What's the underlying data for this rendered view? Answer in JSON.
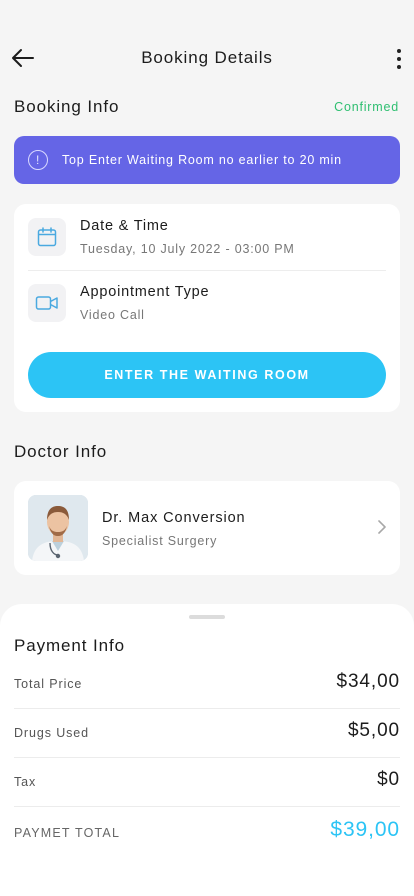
{
  "header": {
    "title": "Booking Details"
  },
  "booking_info": {
    "title": "Booking Info",
    "status": "Confirmed",
    "status_color": "#2fbf71",
    "banner_text": "Top Enter Waiting Room no earlier to 20 min",
    "banner_color": "#6565e6",
    "banner_icon": "info-circle-icon",
    "date_time": {
      "label": "Date & Time",
      "value": "Tuesday, 10 July 2022 - 03:00 PM",
      "icon": "calendar-icon"
    },
    "appointment": {
      "label": "Appointment Type",
      "value": "Video Call",
      "icon": "video-camera-icon"
    },
    "cta_label": "ENTER THE WAITING ROOM",
    "cta_color": "#2cc4f5"
  },
  "doctor_info": {
    "title": "Doctor Info",
    "name": "Dr. Max Conversion",
    "specialty": "Specialist Surgery"
  },
  "payment": {
    "title": "Payment Info",
    "rows": [
      {
        "label": "Total Price",
        "value": "$34,00"
      },
      {
        "label": "Drugs Used",
        "value": "$5,00"
      },
      {
        "label": "Tax",
        "value": "$0"
      }
    ],
    "total_label": "PAYMET TOTAL",
    "total_value": "$39,00"
  }
}
